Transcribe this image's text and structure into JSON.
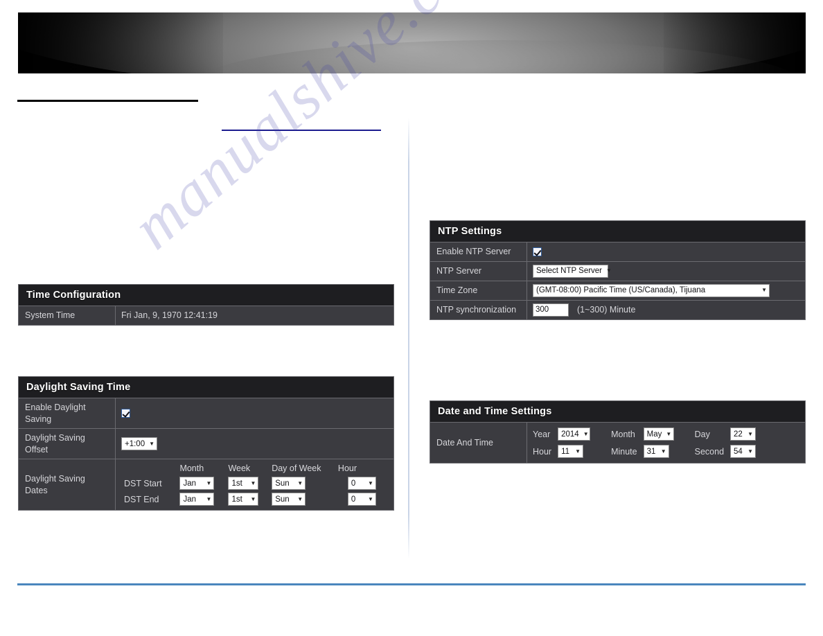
{
  "page": {
    "watermark": "manualshive.com"
  },
  "colors": {
    "panel_header_bg": "#1e1e21",
    "panel_row_bg": "#3b3b40",
    "panel_border": "#6b6b70",
    "accent_blue_rule": "#4a86bd",
    "link_underline": "#1b1b8f"
  },
  "panels": {
    "time_configuration": {
      "title": "Time Configuration",
      "rows": [
        {
          "label": "System Time",
          "value": "Fri Jan, 9, 1970 12:41:19"
        }
      ]
    },
    "daylight_saving": {
      "title": "Daylight Saving Time",
      "enable_label": "Enable Daylight Saving",
      "enable_checked": true,
      "offset_label": "Daylight Saving Offset",
      "offset_value": "+1:00",
      "dates_label": "Daylight Saving Dates",
      "column_headers": [
        "Month",
        "Week",
        "Day of Week",
        "Hour"
      ],
      "rows": [
        {
          "name": "DST Start",
          "month": "Jan",
          "week": "1st",
          "day_of_week": "Sun",
          "hour": "0"
        },
        {
          "name": "DST End",
          "month": "Jan",
          "week": "1st",
          "day_of_week": "Sun",
          "hour": "0"
        }
      ]
    },
    "ntp_settings": {
      "title": "NTP Settings",
      "enable_label": "Enable NTP Server",
      "enable_checked": true,
      "server_label": "NTP Server",
      "server_value": "Select NTP Server",
      "timezone_label": "Time Zone",
      "timezone_value": "(GMT-08:00) Pacific Time (US/Canada), Tijuana",
      "sync_label": "NTP synchronization",
      "sync_value": "300",
      "sync_hint": "(1~300) Minute"
    },
    "date_time_settings": {
      "title": "Date and Time Settings",
      "row_label": "Date And Time",
      "fields": {
        "year_label": "Year",
        "year_value": "2014",
        "month_label": "Month",
        "month_value": "May",
        "day_label": "Day",
        "day_value": "22",
        "hour_label": "Hour",
        "hour_value": "11",
        "minute_label": "Minute",
        "minute_value": "31",
        "second_label": "Second",
        "second_value": "54"
      }
    }
  }
}
